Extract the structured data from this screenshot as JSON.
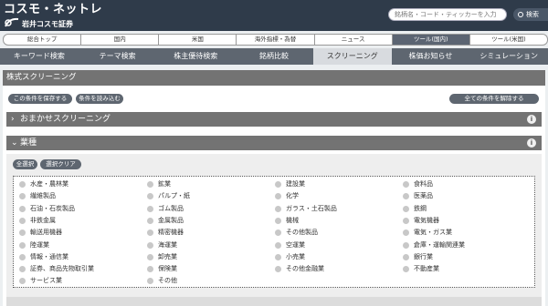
{
  "header": {
    "logo_main": "コスモ・ネットレ",
    "logo_sub": "岩井コスモ証券",
    "search_placeholder": "銘柄名・コード・ティッカーを入力",
    "search_button": "検索"
  },
  "top_tabs": [
    {
      "label": "総合トップ",
      "active": false
    },
    {
      "label": "国内",
      "active": false
    },
    {
      "label": "米国",
      "active": false
    },
    {
      "label": "海外指標・為替",
      "active": false
    },
    {
      "label": "ニュース",
      "active": false
    },
    {
      "label": "ツール(国内)",
      "active": true
    },
    {
      "label": "ツール(米国)",
      "active": false
    }
  ],
  "sub_nav": [
    {
      "label": "キーワード検索",
      "active": false
    },
    {
      "label": "テーマ検索",
      "active": false
    },
    {
      "label": "株主優待検索",
      "active": false
    },
    {
      "label": "銘柄比較",
      "active": false
    },
    {
      "label": "スクリーニング",
      "active": true
    },
    {
      "label": "株価お知らせ",
      "active": false
    },
    {
      "label": "シミュレーション",
      "active": false
    }
  ],
  "page_title": "株式スクリーニング",
  "buttons": {
    "save": "この条件を保存する",
    "load": "条件を読み込む",
    "clear_all": "全ての条件を解除する",
    "select_all": "全選択",
    "clear_selection": "選択クリア"
  },
  "sections": {
    "omakase": {
      "label": "おまかせスクリーニング",
      "chevron": "›"
    },
    "industry": {
      "label": "業種",
      "chevron": "⌄"
    }
  },
  "info_icon": "i",
  "industries": [
    [
      "水産・農林業",
      "鉱業",
      "建設業",
      "食料品"
    ],
    [
      "繊維製品",
      "パルプ・紙",
      "化学",
      "医薬品"
    ],
    [
      "石油・石炭製品",
      "ゴム製品",
      "ガラス・土石製品",
      "鉄鋼"
    ],
    [
      "非鉄金属",
      "金属製品",
      "機械",
      "電気機器"
    ],
    [
      "輸送用機器",
      "精密機器",
      "その他製品",
      "電気・ガス業"
    ],
    [
      "陸運業",
      "海運業",
      "空運業",
      "倉庫・運輸関連業"
    ],
    [
      "情報・通信業",
      "卸売業",
      "小売業",
      "銀行業"
    ],
    [
      "証券、商品先物取引業",
      "保険業",
      "その他金融業",
      "不動産業"
    ],
    [
      "サービス業",
      "その他",
      "",
      ""
    ]
  ],
  "colors": {
    "header_bg": "#2f3b4a",
    "nav_bg": "#5e6670",
    "section_bg": "#737373",
    "checkbox": "#c8c8c8"
  }
}
